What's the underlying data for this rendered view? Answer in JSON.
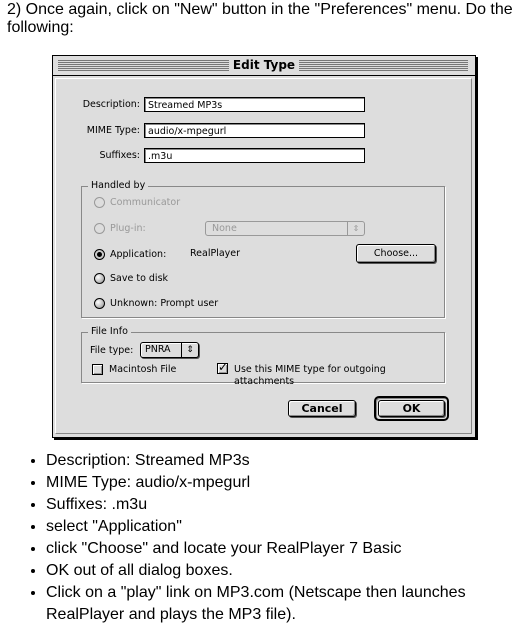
{
  "intro": "2) Once again, click on \"New\" button in the \"Preferences\" menu. Do the following:",
  "dialog": {
    "title": "Edit Type",
    "fields": {
      "description_label": "Description:",
      "description_value": "Streamed MP3s",
      "mime_label": "MIME Type:",
      "mime_value": "audio/x-mpegurl",
      "suffixes_label": "Suffixes:",
      "suffixes_value": ".m3u"
    },
    "handled_by": {
      "title": "Handled by",
      "communicator": {
        "label": "Communicator",
        "enabled": false,
        "selected": false
      },
      "plugin": {
        "label": "Plug-in:",
        "enabled": false,
        "selected": false,
        "popup_value": "None"
      },
      "application": {
        "label": "Application:",
        "enabled": true,
        "selected": true,
        "app_name": "RealPlayer"
      },
      "save_to_disk": {
        "label": "Save to disk",
        "enabled": true,
        "selected": false
      },
      "unknown": {
        "label": "Unknown: Prompt user",
        "enabled": true,
        "selected": false
      },
      "choose_button": "Choose..."
    },
    "file_info": {
      "title": "File Info",
      "file_type_label": "File type:",
      "file_type_value": "PNRA",
      "macintosh_file": {
        "label": "Macintosh File",
        "checked": false
      },
      "use_mime": {
        "label": "Use this MIME type for outgoing attachments",
        "checked": true
      }
    },
    "buttons": {
      "cancel": "Cancel",
      "ok": "OK"
    },
    "icons": {
      "popup_arrows": "⇕",
      "checkmark": "✓"
    }
  },
  "steps": [
    "Description: Streamed MP3s",
    "MIME Type: audio/x-mpegurl",
    "Suffixes: .m3u",
    "select \"Application\"",
    "click \"Choose\" and locate your RealPlayer 7 Basic",
    "OK out of all dialog boxes.",
    "Click on a \"play\" link on MP3.com (Netscape then launches RealPlayer and plays the MP3 file)."
  ]
}
